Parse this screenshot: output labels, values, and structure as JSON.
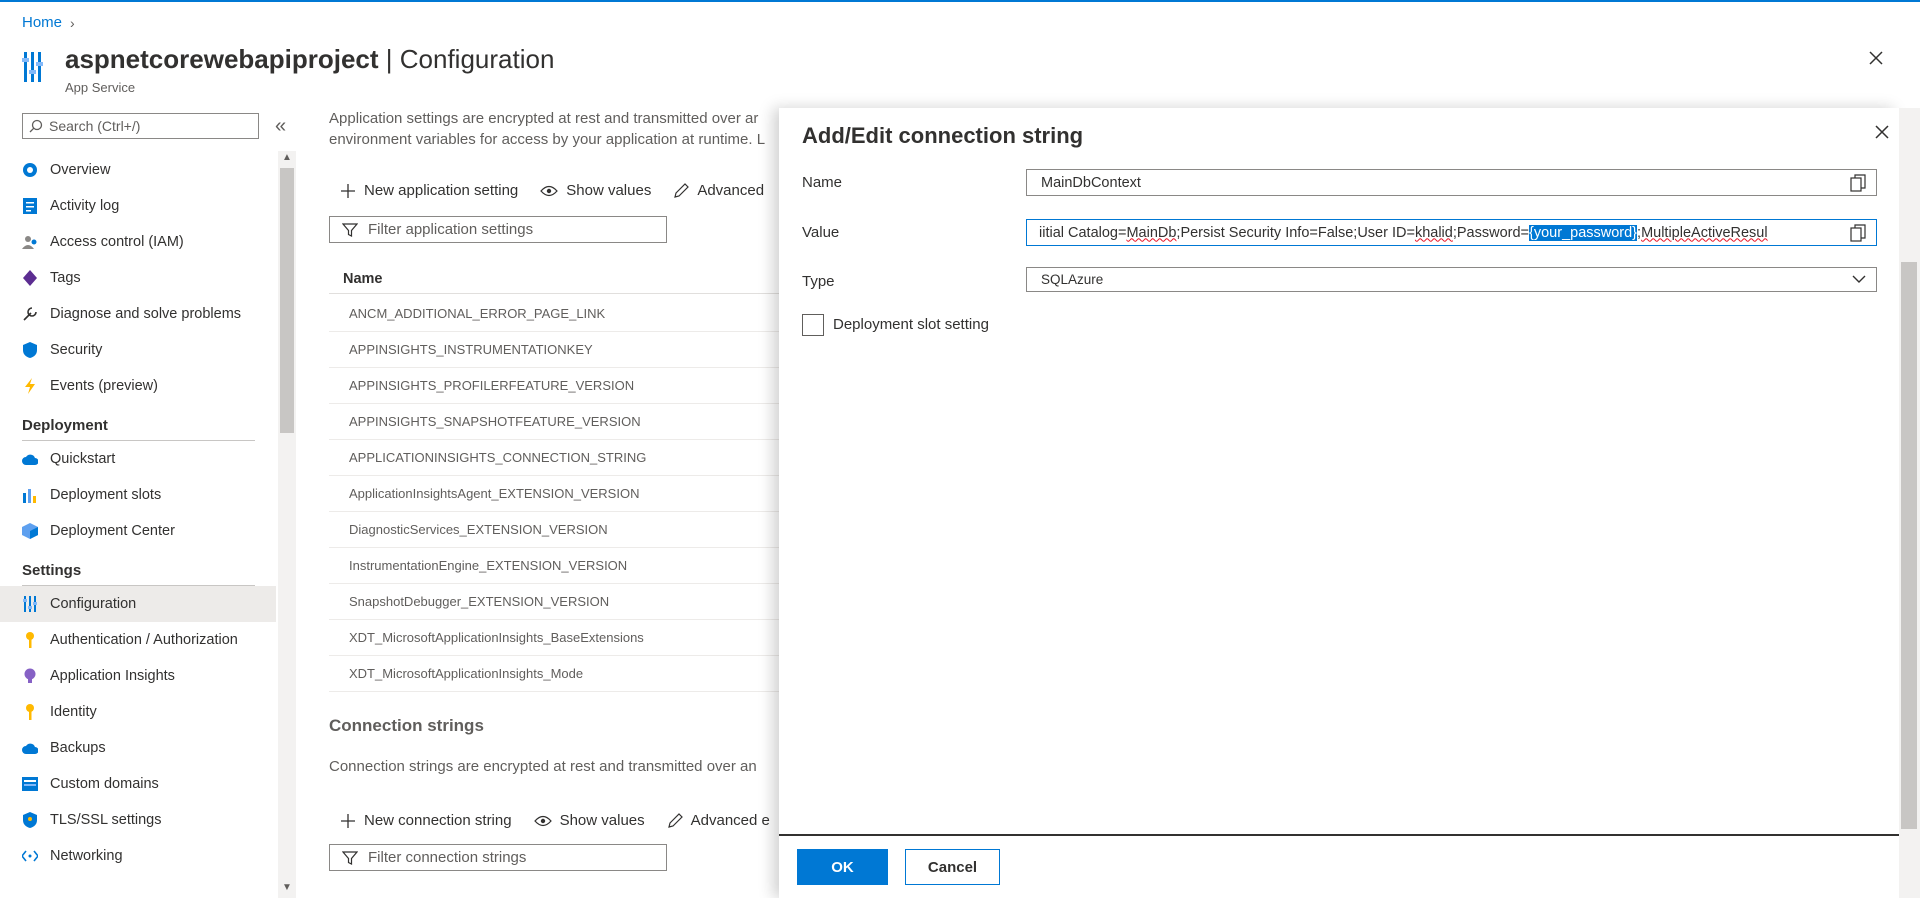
{
  "breadcrumb": {
    "home": "Home"
  },
  "header": {
    "resource_name": "aspnetcorewebapiproject",
    "separator": " | ",
    "page": "Configuration",
    "resource_type": "App Service"
  },
  "sidebar": {
    "search_placeholder": "Search (Ctrl+/)",
    "collapse_glyph": "«",
    "items_top": [
      {
        "label": "Overview",
        "icon": "overview-icon"
      },
      {
        "label": "Activity log",
        "icon": "activity-log-icon"
      },
      {
        "label": "Access control (IAM)",
        "icon": "iam-icon"
      },
      {
        "label": "Tags",
        "icon": "tag-icon"
      },
      {
        "label": "Diagnose and solve problems",
        "icon": "wrench-icon"
      },
      {
        "label": "Security",
        "icon": "shield-icon"
      },
      {
        "label": "Events (preview)",
        "icon": "lightning-icon"
      }
    ],
    "section_deployment": "Deployment",
    "items_deployment": [
      {
        "label": "Quickstart",
        "icon": "cloud-icon"
      },
      {
        "label": "Deployment slots",
        "icon": "slots-icon"
      },
      {
        "label": "Deployment Center",
        "icon": "cube-icon"
      }
    ],
    "section_settings": "Settings",
    "items_settings": [
      {
        "label": "Configuration",
        "icon": "config-icon"
      },
      {
        "label": "Authentication / Authorization",
        "icon": "key-icon"
      },
      {
        "label": "Application Insights",
        "icon": "bulb-icon"
      },
      {
        "label": "Identity",
        "icon": "identity-key-icon"
      },
      {
        "label": "Backups",
        "icon": "backup-cloud-icon"
      },
      {
        "label": "Custom domains",
        "icon": "domain-icon"
      },
      {
        "label": "TLS/SSL settings",
        "icon": "tls-shield-icon"
      },
      {
        "label": "Networking",
        "icon": "network-icon"
      }
    ]
  },
  "main": {
    "desc_line1": "Application settings are encrypted at rest and transmitted over ar",
    "desc_line2": "environment variables for access by your application at runtime. L",
    "toolbar": {
      "new_setting": "New application setting",
      "show_values": "Show values",
      "advanced": "Advanced"
    },
    "filter_placeholder": "Filter application settings",
    "table_header": "Name",
    "settings": [
      "ANCM_ADDITIONAL_ERROR_PAGE_LINK",
      "APPINSIGHTS_INSTRUMENTATIONKEY",
      "APPINSIGHTS_PROFILERFEATURE_VERSION",
      "APPINSIGHTS_SNAPSHOTFEATURE_VERSION",
      "APPLICATIONINSIGHTS_CONNECTION_STRING",
      "ApplicationInsightsAgent_EXTENSION_VERSION",
      "DiagnosticServices_EXTENSION_VERSION",
      "InstrumentationEngine_EXTENSION_VERSION",
      "SnapshotDebugger_EXTENSION_VERSION",
      "XDT_MicrosoftApplicationInsights_BaseExtensions",
      "XDT_MicrosoftApplicationInsights_Mode"
    ],
    "cs_title": "Connection strings",
    "cs_desc": "Connection strings are encrypted at rest and transmitted over an",
    "toolbar2": {
      "new_cs": "New connection string",
      "show_values": "Show values",
      "advanced": "Advanced e"
    },
    "filter2_placeholder": "Filter connection strings"
  },
  "panel": {
    "title": "Add/Edit connection string",
    "name_label": "Name",
    "name_value": "MainDbContext",
    "value_label": "Value",
    "value_parts": {
      "p1": "iitial Catalog=",
      "p2": "MainDb",
      "p3": ";Persist Security Info=False;User ID=",
      "p4": "khalid",
      "p5": ";Password=",
      "p6": "{your_password}",
      "p7": ";",
      "p8": "MultipleActiveResul"
    },
    "type_label": "Type",
    "type_value": "SQLAzure",
    "slot_label": "Deployment slot setting",
    "ok": "OK",
    "cancel": "Cancel"
  },
  "colors": {
    "accent": "#0078d4",
    "text": "#323130",
    "muted": "#605e5c"
  }
}
